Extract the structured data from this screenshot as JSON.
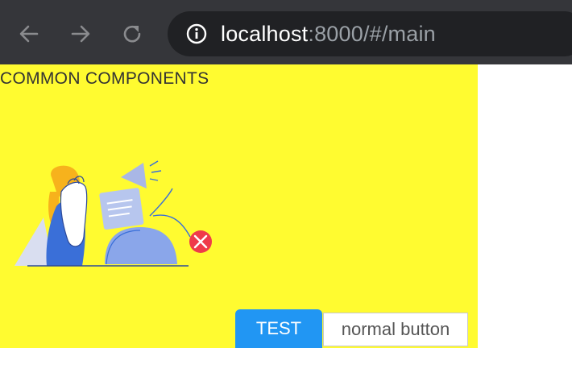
{
  "browser": {
    "url_host": "localhost",
    "url_rest": ":8000/#/main",
    "icons": {
      "back": "arrow-left-icon",
      "forward": "arrow-right-icon",
      "reload": "reload-icon",
      "site_info": "info-icon"
    }
  },
  "page": {
    "title": "COMMON COMPONENTS",
    "background_color": "#fffb30"
  },
  "buttons": {
    "test_label": "TEST",
    "normal_label": "normal button",
    "test_color": "#2196f3"
  }
}
